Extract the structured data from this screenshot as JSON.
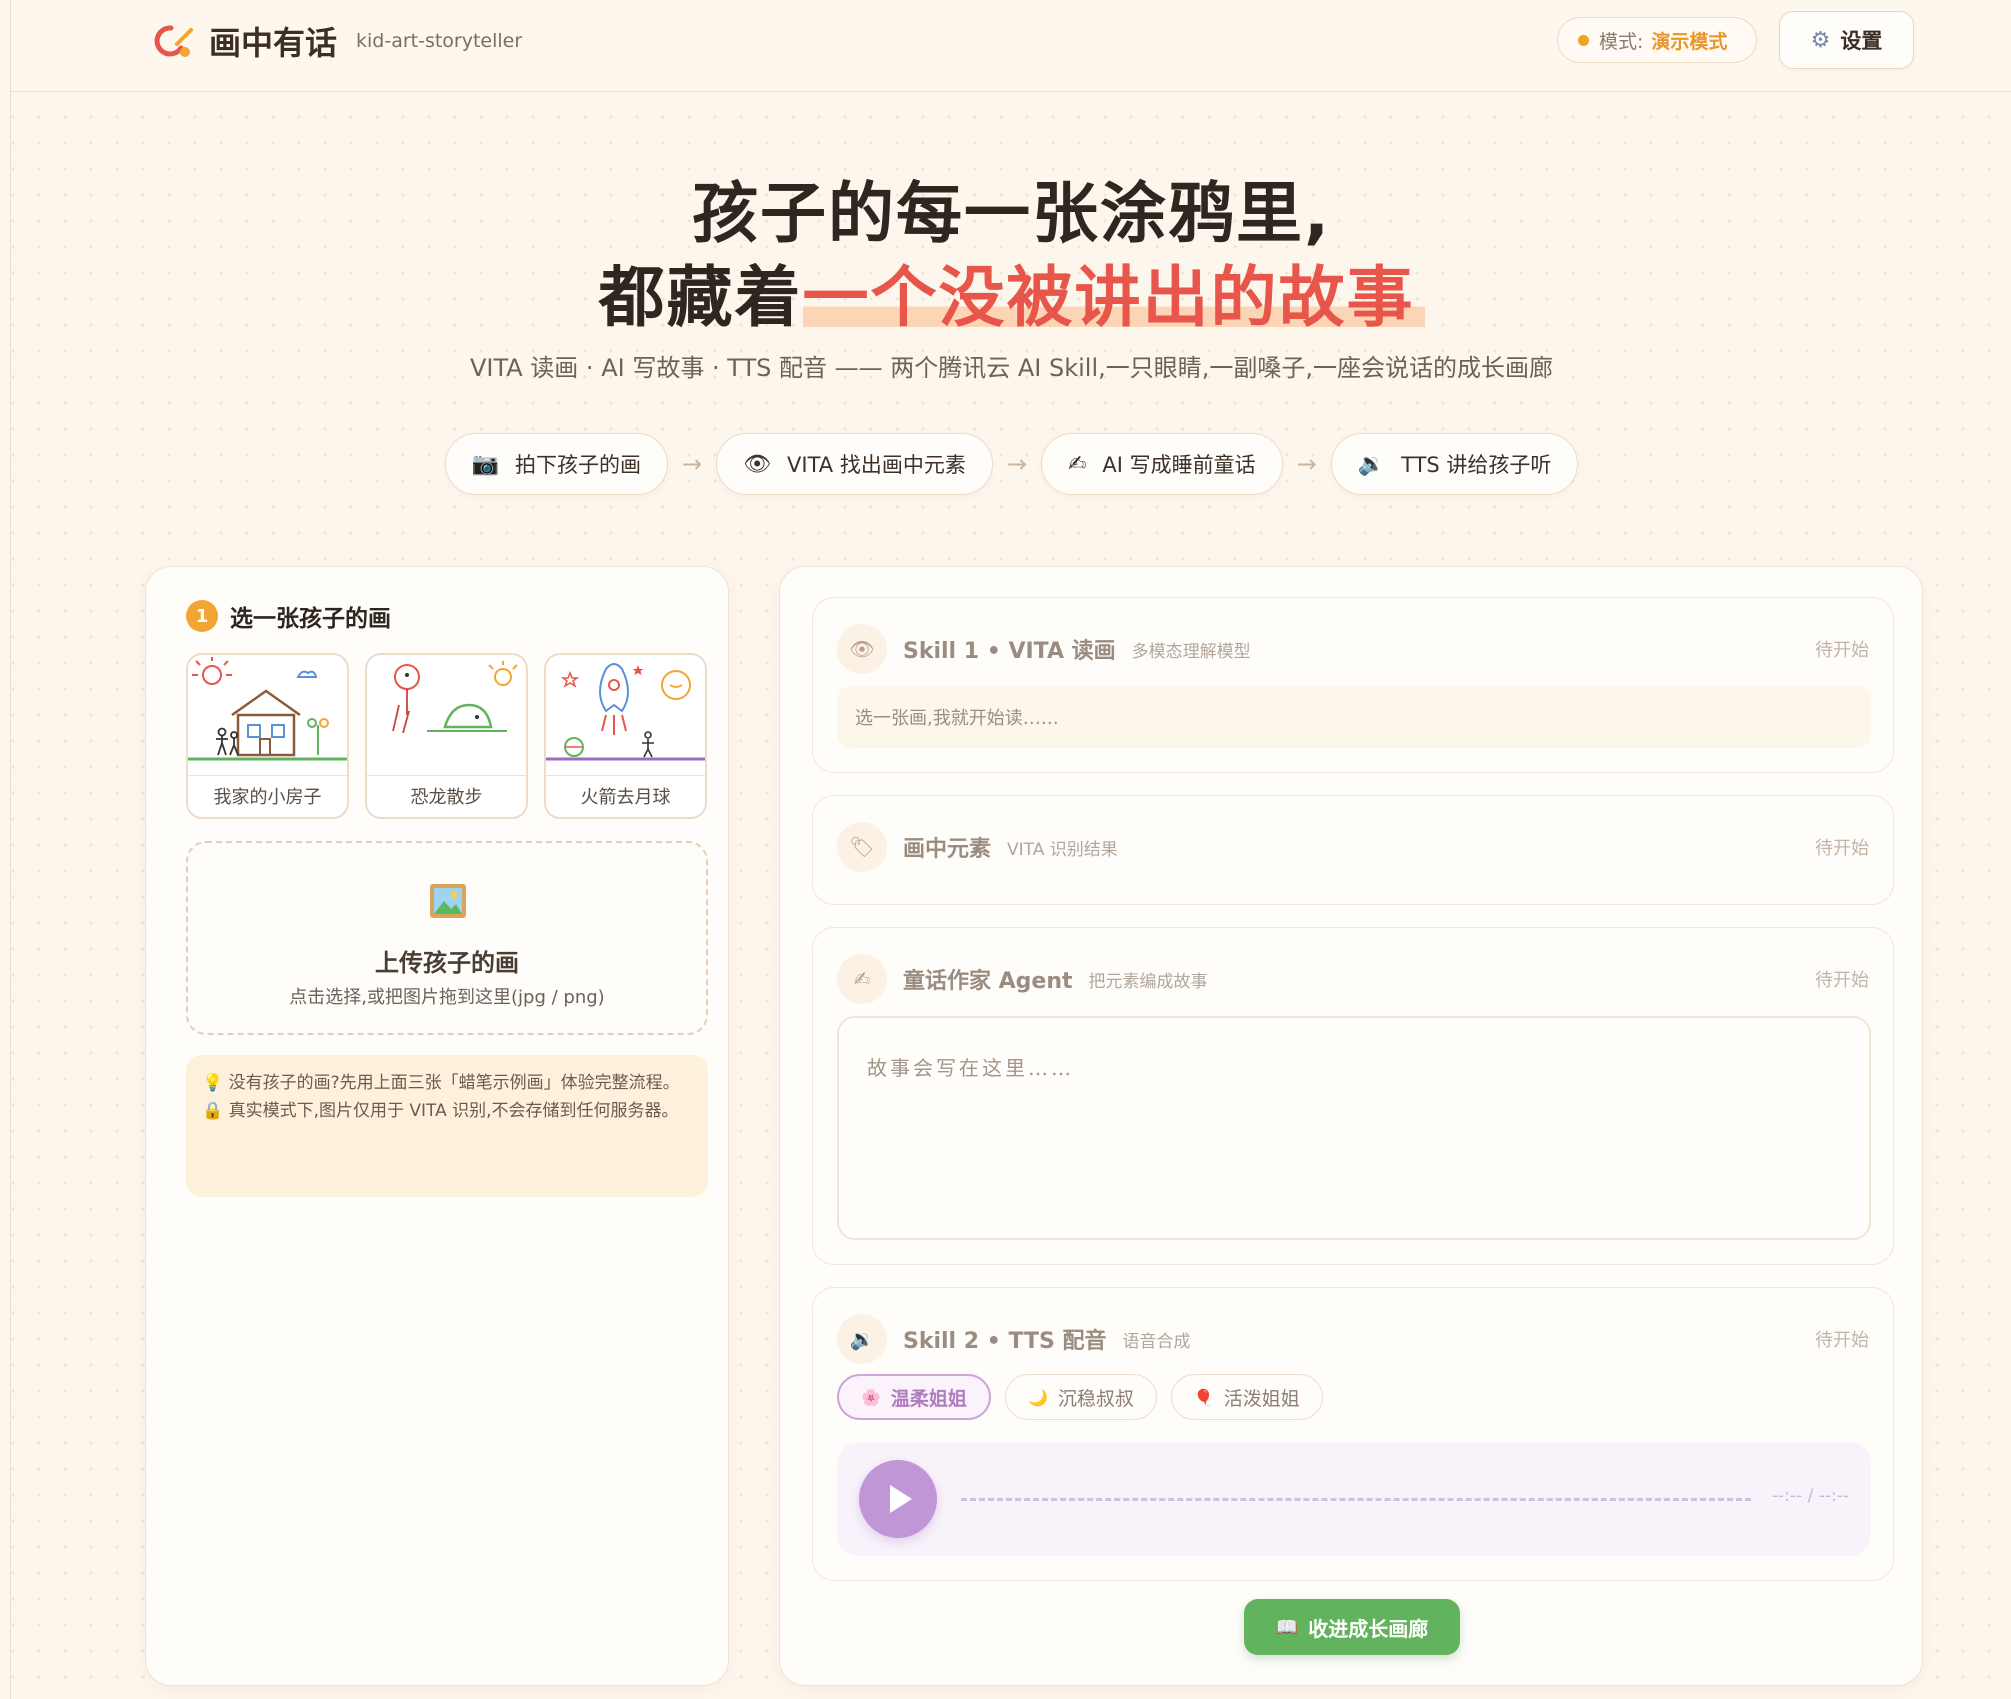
{
  "header": {
    "app_title": "画中有话",
    "app_subtitle": "kid-art-storyteller",
    "mode_label": "模式:",
    "mode_value": "演示模式",
    "settings_label": "设置",
    "settings_icon": "gear-icon"
  },
  "hero": {
    "line1": "孩子的每一张涂鸦里,",
    "line2_prefix": "都藏着",
    "line2_highlight": "一个没被讲出的故事",
    "subtitle": "VITA 读画 · AI 写故事 · TTS 配音 —— 两个腾讯云 AI Skill,一只眼睛,一副嗓子,一座会说话的成长画廊"
  },
  "steps": [
    {
      "icon": "📷",
      "label": "拍下孩子的画"
    },
    {
      "icon": "👁",
      "label": "VITA 找出画中元素"
    },
    {
      "icon": "✍",
      "label": "AI 写成睡前童话"
    },
    {
      "icon": "🔉",
      "label": "TTS 讲给孩子听"
    }
  ],
  "step_arrow": "→",
  "left": {
    "section_number": "1",
    "section_title": "选一张孩子的画",
    "samples": [
      {
        "caption": "我家的小房子"
      },
      {
        "caption": "恐龙散步"
      },
      {
        "caption": "火箭去月球"
      }
    ],
    "upload_title": "上传孩子的画",
    "upload_hint": "点击选择,或把图片拖到这里(jpg / png)",
    "tip1": "💡 没有孩子的画?先用上面三张「蜡笔示例画」体验完整流程。",
    "tip2": "🔒 真实模式下,图片仅用于 VITA 识别,不会存储到任何服务器。"
  },
  "right": {
    "skill1": {
      "icon": "👁",
      "title": "Skill 1 • VITA 读画",
      "subtitle": "多模态理解模型",
      "status": "待开始",
      "placeholder": "选一张画,我就开始读……"
    },
    "elements": {
      "icon": "🏷",
      "title": "画中元素",
      "subtitle": "VITA 识别结果",
      "status": "待开始"
    },
    "writer": {
      "icon": "✍",
      "title": "童话作家 Agent",
      "subtitle": "把元素编成故事",
      "status": "待开始",
      "placeholder": "故事会写在这里……"
    },
    "skill2": {
      "icon": "🔉",
      "title": "Skill 2 • TTS 配音",
      "subtitle": "语音合成",
      "status": "待开始",
      "voices": [
        {
          "icon": "🌸",
          "label": "温柔姐姐",
          "selected": true
        },
        {
          "icon": "🌙",
          "label": "沉稳叔叔",
          "selected": false
        },
        {
          "icon": "🎈",
          "label": "活泼姐姐",
          "selected": false
        }
      ],
      "time": "--:-- / --:--"
    },
    "collect_label": "收进成长画廊",
    "collect_icon": "📖"
  },
  "colors": {
    "accent": "#e8554a",
    "mode": "#e8962a",
    "voice_active": "#b07cc0",
    "collect": "#62b35d"
  }
}
